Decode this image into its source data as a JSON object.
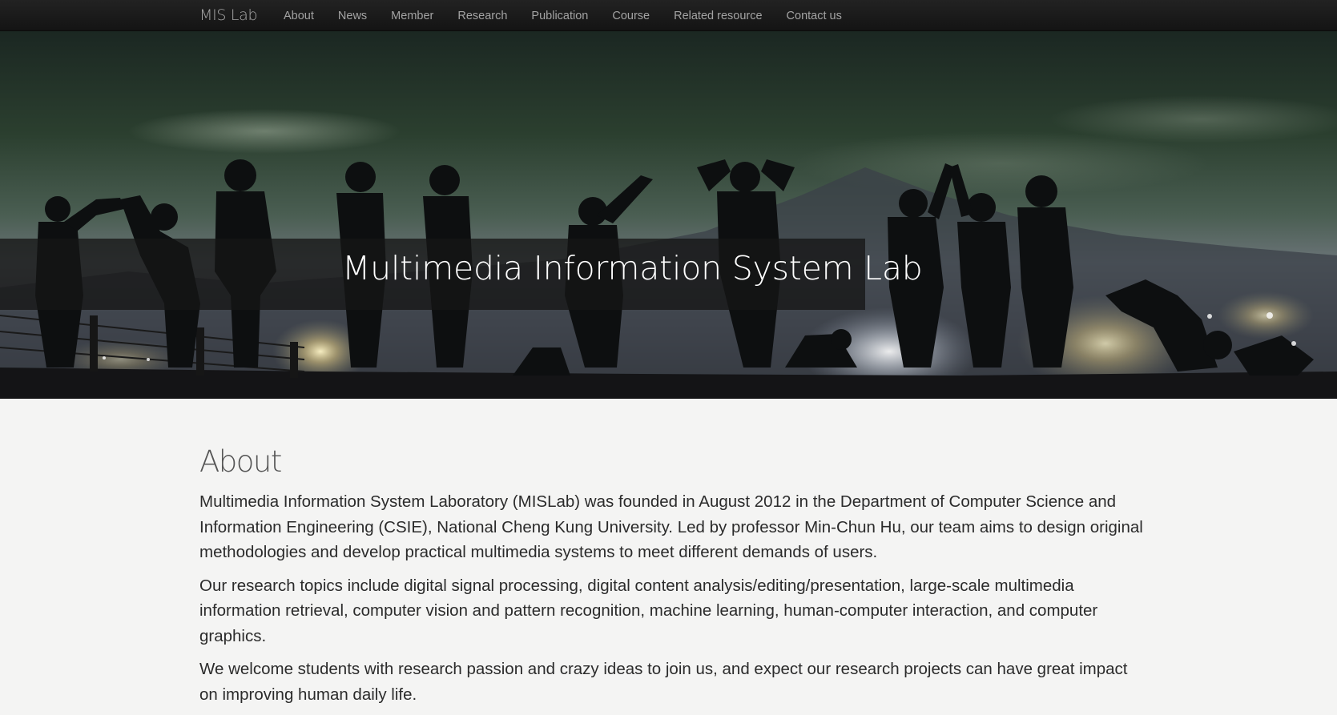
{
  "navbar": {
    "brand": "MIS Lab",
    "links": [
      "About",
      "News",
      "Member",
      "Research",
      "Publication",
      "Course",
      "Related resource",
      "Contact us"
    ]
  },
  "hero": {
    "title": "Multimedia Information System Lab"
  },
  "about": {
    "heading": "About",
    "paragraphs": [
      "Multimedia Information System Laboratory (MISLab) was founded in August 2012 in the Department of Computer Science and Information Engineering (CSIE), National Cheng Kung University. Led by professor Min-Chun Hu, our team aims to design original methodologies and develop practical multimedia systems to meet different demands of users.",
      "Our research topics include digital signal processing, digital content analysis/editing/presentation, large-scale multimedia information retrieval, computer vision and pattern recognition, machine learning, human-computer interaction, and computer graphics.",
      "We welcome students with research passion and crazy ideas to join us, and expect our research projects can have great impact on improving human daily life."
    ]
  },
  "colors": {
    "navbar_bg": "#1b1b1b",
    "nav_text": "#a3a3a3",
    "page_bg": "#f4f4f3",
    "body_text": "#2b2b2b"
  }
}
